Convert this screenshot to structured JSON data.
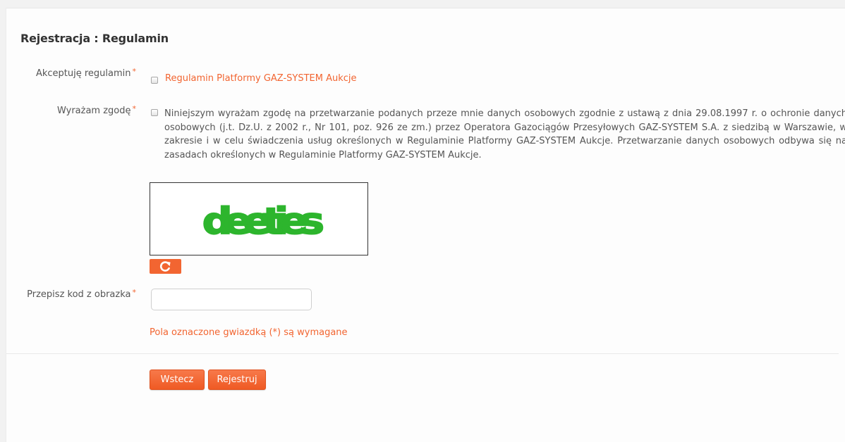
{
  "header": {
    "title": "Rejestracja : Regulamin"
  },
  "terms": {
    "label": "Akceptuję regulamin",
    "required_mark": "*",
    "link_text": "Regulamin Platformy GAZ-SYSTEM Aukcje",
    "checked": false
  },
  "consent": {
    "label": "Wyrażam zgodę",
    "required_mark": "*",
    "text": "Niniejszym wyrażam zgodę na przetwarzanie podanych przeze mnie danych osobowych zgodnie z ustawą z dnia 29.08.1997 r. o ochronie danych osobowych (j.t. Dz.U. z 2002 r., Nr 101, poz. 926 ze zm.) przez Operatora Gazociągów Przesyłowych GAZ-SYSTEM S.A. z siedzibą w Warszawie, w zakresie i w celu świadczenia usług określonych w Regulaminie Platformy GAZ-SYSTEM Aukcje. Przetwarzanie danych osobowych odbywa się na zasadach określonych w Regulaminie Platformy GAZ-SYSTEM Aukcje.",
    "checked": false
  },
  "captcha": {
    "code": "deeties",
    "code_color": "#2db52d",
    "refresh_icon": "refresh-icon"
  },
  "code_field": {
    "label": "Przepisz kod z obrazka",
    "required_mark": "*",
    "value": ""
  },
  "required_note": "Pola oznaczone gwiazdką (*) są wymagane",
  "buttons": {
    "back_label": "Wstecz",
    "register_label": "Rejestruj"
  },
  "colors": {
    "accent": "#f26531",
    "text": "#555555",
    "title": "#333333",
    "background": "#f2f2f2"
  }
}
